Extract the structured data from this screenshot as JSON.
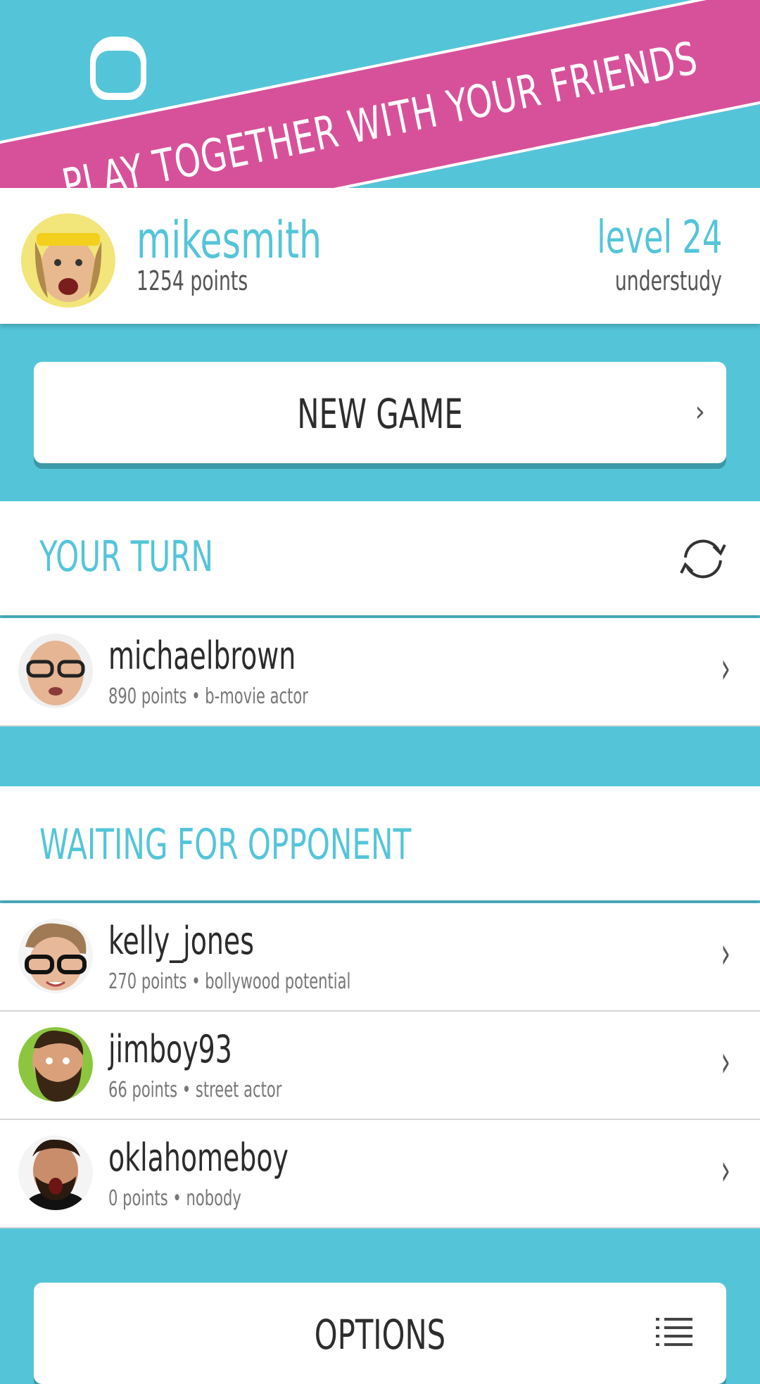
{
  "banner": {
    "text": "PLAY TOGETHER WITH YOUR FRIENDS"
  },
  "profile": {
    "username": "mikesmith",
    "points": "1254 points",
    "level": "level 24",
    "rank": "understudy"
  },
  "new_game": {
    "label": "NEW GAME",
    "chevron": "›"
  },
  "your_turn": {
    "title": "YOUR TURN",
    "refresh_icon": "refresh-icon",
    "players": [
      {
        "name": "michaelbrown",
        "subtitle": "890 points • b-movie actor"
      }
    ]
  },
  "waiting": {
    "title": "WAITING FOR OPPONENT",
    "players": [
      {
        "name": "kelly_jones",
        "subtitle": "270 points • bollywood potential"
      },
      {
        "name": "jimboy93",
        "subtitle": "66 points • street actor"
      },
      {
        "name": "oklahomeboy",
        "subtitle": "0 points • nobody"
      }
    ]
  },
  "options": {
    "label": "OPTIONS",
    "icon": "list-icon"
  },
  "row_chevron": "›",
  "colors": {
    "accent": "#54c5d9",
    "banner": "#d7519a",
    "text": "#2b2b2b"
  }
}
